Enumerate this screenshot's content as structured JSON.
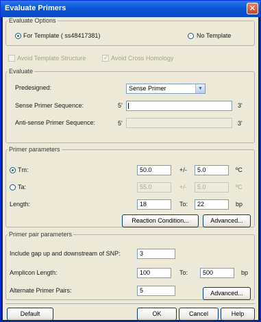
{
  "window": {
    "title": "Evaluate Primers"
  },
  "evaluate_options": {
    "legend": "Evaluate Options",
    "for_template_label": "For Template ( ss48417381)",
    "no_template_label": "No Template",
    "for_template_selected": true,
    "avoid_template_structure": "Avoid Template Structure",
    "avoid_cross_homology": "Avoid Cross Homology"
  },
  "evaluate": {
    "legend": "Evaluate",
    "predesigned_label": "Predesigned:",
    "predesigned_value": "Sense Primer",
    "sense_label": "Sense Primer Sequence:",
    "sense_prefix": "5'",
    "sense_suffix": "3'",
    "sense_value": "",
    "antisense_label": "Anti-sense Primer Sequence:",
    "antisense_prefix": "5'",
    "antisense_suffix": "3'",
    "antisense_value": ""
  },
  "primer_parameters": {
    "legend": "Primer parameters",
    "tm_label": "Tm:",
    "tm_value": "50.0",
    "tm_pm": "+/-",
    "tm_tol": "5.0",
    "tm_unit": "ºC",
    "ta_label": "Ta:",
    "ta_value": "55.0",
    "ta_pm": "+/-",
    "ta_tol": "5.0",
    "ta_unit": "ºC",
    "length_label": "Length:",
    "length_from": "18",
    "length_to_label": "To:",
    "length_to": "22",
    "length_unit": "bp",
    "reaction_button": "Reaction Condition...",
    "advanced_button": "Advanced..."
  },
  "primer_pair": {
    "legend": "Primer pair parameters",
    "gap_label": "Include gap up and downstream of SNP:",
    "gap_value": "3",
    "amplicon_label": "Amplicon Length:",
    "amplicon_from": "100",
    "amplicon_to_label": "To:",
    "amplicon_to": "500",
    "amplicon_unit": "bp",
    "alternate_label": "Alternate Primer Pairs:",
    "alternate_value": "5",
    "advanced_button": "Advanced..."
  },
  "footer": {
    "default_button": "Default",
    "ok_button": "OK",
    "cancel_button": "Cancel",
    "help_button": "Help"
  }
}
